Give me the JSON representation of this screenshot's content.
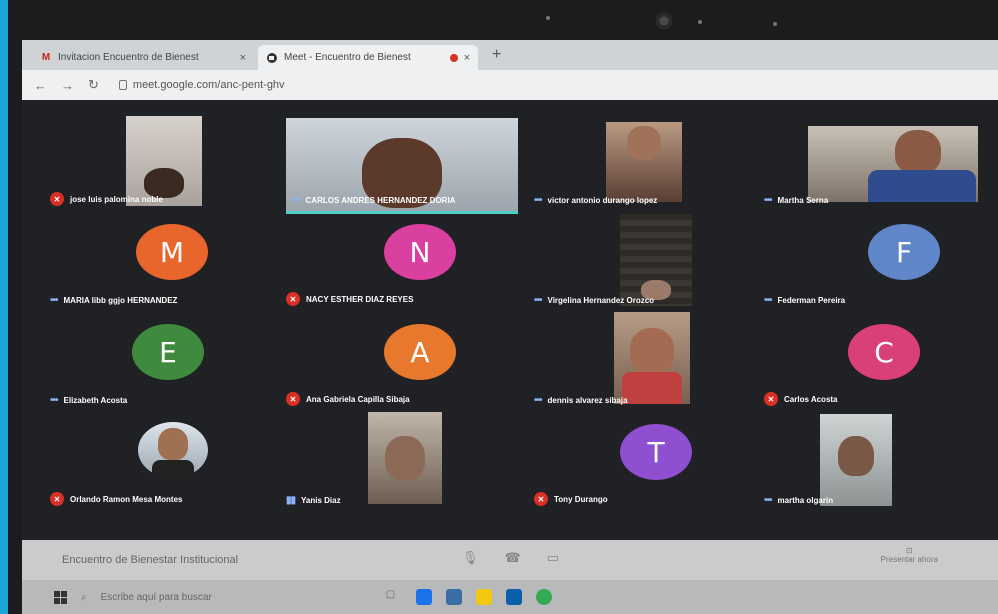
{
  "browser": {
    "tabs": [
      {
        "favicon": "M",
        "title": "Invitacion Encuentro de Bienest",
        "close": "×"
      },
      {
        "favicon": "meet-icon",
        "title": "Meet - Encuentro de Bienest",
        "close": "×"
      }
    ],
    "new_tab": "+",
    "url": "meet.google.com/anc-pent-ghv"
  },
  "participants": [
    {
      "name": "jose luis palomina noble",
      "mic": "muted",
      "type": "video"
    },
    {
      "name": "CARLOS ANDRES HERNANDEZ DORIA",
      "mic": "on",
      "type": "video",
      "speaking": true
    },
    {
      "name": "victor antonio durango lopez",
      "mic": "on",
      "type": "video"
    },
    {
      "name": "Martha Serna",
      "mic": "on",
      "type": "video"
    },
    {
      "name": "MARIA libb ggjo HERNANDEZ",
      "mic": "on",
      "type": "avatar",
      "initial": "M",
      "color": "#e8662c"
    },
    {
      "name": "NACY ESTHER DIAZ REYES",
      "mic": "muted",
      "type": "avatar",
      "initial": "N",
      "color": "#d9409f"
    },
    {
      "name": "Virgelina Hernandez Orozco",
      "mic": "on",
      "type": "video"
    },
    {
      "name": "Federman Pereira",
      "mic": "on",
      "type": "avatar",
      "initial": "F",
      "color": "#5f86c9"
    },
    {
      "name": "Elizabeth Acosta",
      "mic": "on",
      "type": "avatar",
      "initial": "E",
      "color": "#3f8a3d"
    },
    {
      "name": "Ana Gabriela Capilla Sibaja",
      "mic": "muted",
      "type": "avatar",
      "initial": "A",
      "color": "#e8782c"
    },
    {
      "name": "dennis alvarez sibaja",
      "mic": "on",
      "type": "video"
    },
    {
      "name": "Carlos Acosta",
      "mic": "muted",
      "type": "avatar",
      "initial": "C",
      "color": "#d9407a"
    },
    {
      "name": "Orlando Ramon Mesa Montes",
      "mic": "muted",
      "type": "video"
    },
    {
      "name": "Yanis Diaz",
      "mic": "on",
      "type": "video"
    },
    {
      "name": "Tony Durango",
      "mic": "muted",
      "type": "avatar",
      "initial": "T",
      "color": "#8e4fd0"
    },
    {
      "name": "martha olgarin",
      "mic": "on",
      "type": "video"
    }
  ],
  "meeting_bar": {
    "title": "Encuentro de Bienestar Institucional",
    "present_label": "Presentar ahora"
  },
  "taskbar": {
    "search_placeholder": "Escribe aquí para buscar"
  }
}
